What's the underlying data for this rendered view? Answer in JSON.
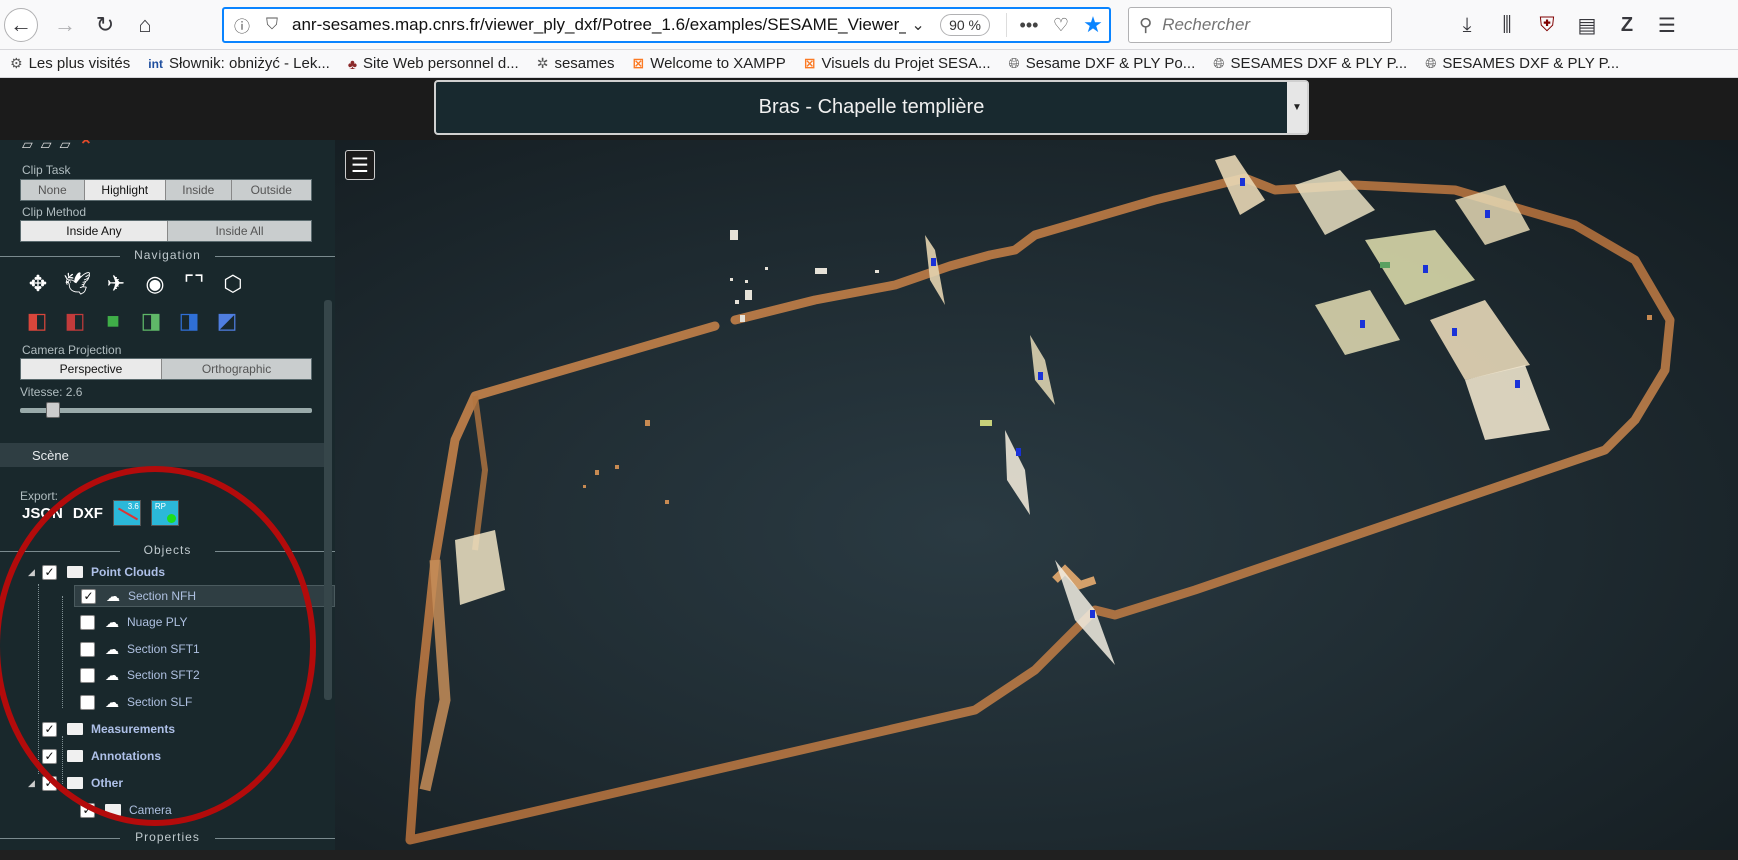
{
  "browser": {
    "url": "anr-sesames.map.cnrs.fr/viewer_ply_dxf/Potree_1.6/examples/SESAME_Viewer_\\",
    "zoom": "90 %",
    "search_placeholder": "Rechercher"
  },
  "bookmarks": [
    {
      "label": "Les plus visités",
      "icon": "gear-icon"
    },
    {
      "label": "Słownik: obniżyć - Lek...",
      "icon": "int-icon"
    },
    {
      "label": "Site Web personnel d...",
      "icon": "tree-icon"
    },
    {
      "label": "sesames",
      "icon": "sesames-icon"
    },
    {
      "label": "Welcome to XAMPP",
      "icon": "xampp-icon"
    },
    {
      "label": "Visuels du Projet SESA...",
      "icon": "xampp-icon"
    },
    {
      "label": "Sesame DXF & PLY Po...",
      "icon": "globe-icon"
    },
    {
      "label": "SESAMES DXF & PLY P...",
      "icon": "globe-icon"
    },
    {
      "label": "SESAMES DXF & PLY P...",
      "icon": "globe-icon"
    }
  ],
  "scene_select": {
    "value": "Bras - Chapelle templière"
  },
  "sidebar": {
    "clip_task": {
      "label": "Clip Task",
      "options": [
        "None",
        "Highlight",
        "Inside",
        "Outside"
      ],
      "active": "Highlight"
    },
    "clip_method": {
      "label": "Clip Method",
      "options": [
        "Inside Any",
        "Inside All"
      ],
      "active": "Inside Any"
    },
    "navigation_title": "Navigation",
    "camera_projection": {
      "label": "Camera Projection",
      "options": [
        "Perspective",
        "Orthographic"
      ],
      "active": "Perspective"
    },
    "speed": {
      "label": "Vitesse: 2.6",
      "value": 2.6
    },
    "scene_header": "Scène",
    "export": {
      "label": "Export:",
      "json": "JSON",
      "dxf": "DXF",
      "img1_text": "3.6",
      "img2_text": "RP"
    },
    "objects_title": "Objects",
    "tree": {
      "point_clouds": "Point Clouds",
      "clouds": [
        {
          "label": "Section NFH",
          "checked": true
        },
        {
          "label": "Nuage PLY",
          "checked": false
        },
        {
          "label": "Section SFT1",
          "checked": false
        },
        {
          "label": "Section SFT2",
          "checked": false
        },
        {
          "label": "Section SLF",
          "checked": false
        }
      ],
      "measurements": "Measurements",
      "annotations": "Annotations",
      "other": "Other",
      "camera": "Camera"
    },
    "properties_title": "Properties"
  },
  "viewer": {
    "menu_icon": "☰"
  }
}
